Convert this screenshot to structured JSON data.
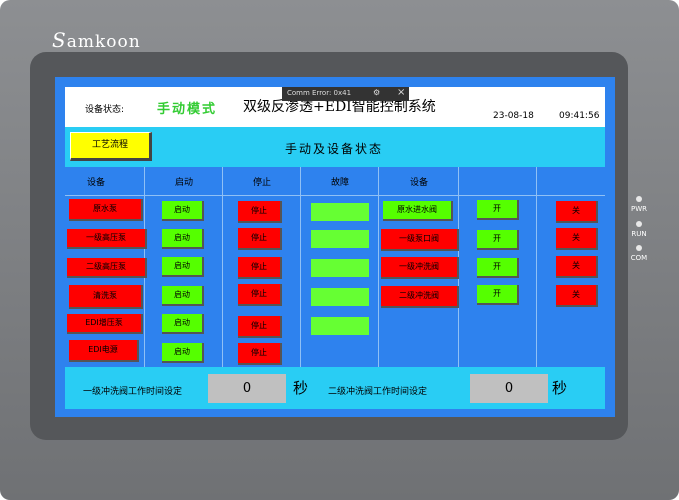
{
  "device": {
    "brand": "amkoon",
    "brand_initial": "S",
    "leds": [
      "PWR",
      "RUN",
      "COM"
    ]
  },
  "topbar": {
    "status_label": "设备状态:",
    "mode": "手动模式",
    "title": "双级反渗透+EDI智能控制系统",
    "date": "23-08-18",
    "time": "09:41:56"
  },
  "error_popup": {
    "text": "Comm Error: 0x41",
    "gear_icon": "gear-icon",
    "close_icon": "close-icon"
  },
  "header": {
    "process_button": "工艺流程",
    "title": "手动及设备状态"
  },
  "columns": [
    "设备",
    "启动",
    "停止",
    "故障",
    "设备",
    "",
    ""
  ],
  "rows": [
    {
      "device": "原水泵",
      "start": "启动",
      "stop": "停止",
      "fault": true,
      "device2": "原水进水阀",
      "open": "开",
      "close": "关"
    },
    {
      "device": "一级高压泵",
      "start": "启动",
      "stop": "停止",
      "fault": true,
      "device2": "一级泵口阀",
      "open": "开",
      "close": "关"
    },
    {
      "device": "二级高压泵",
      "start": "启动",
      "stop": "停止",
      "fault": true,
      "device2": "一级冲洗阀",
      "open": "开",
      "close": "关"
    },
    {
      "device": "清洗泵",
      "start": "启动",
      "stop": "停止",
      "fault": true,
      "device2": "二级冲洗阀",
      "open": "开",
      "close": "关"
    },
    {
      "device": "EDI增压泵",
      "start": "启动",
      "stop": "停止",
      "fault": true
    },
    {
      "device": "EDI电源",
      "start": "启动",
      "stop": "停止"
    }
  ],
  "footer": {
    "label1": "一级冲洗阀工作时间设定",
    "value1": "0",
    "unit1": "秒",
    "label2": "二级冲洗阀工作时间设定",
    "value2": "0",
    "unit2": "秒"
  }
}
